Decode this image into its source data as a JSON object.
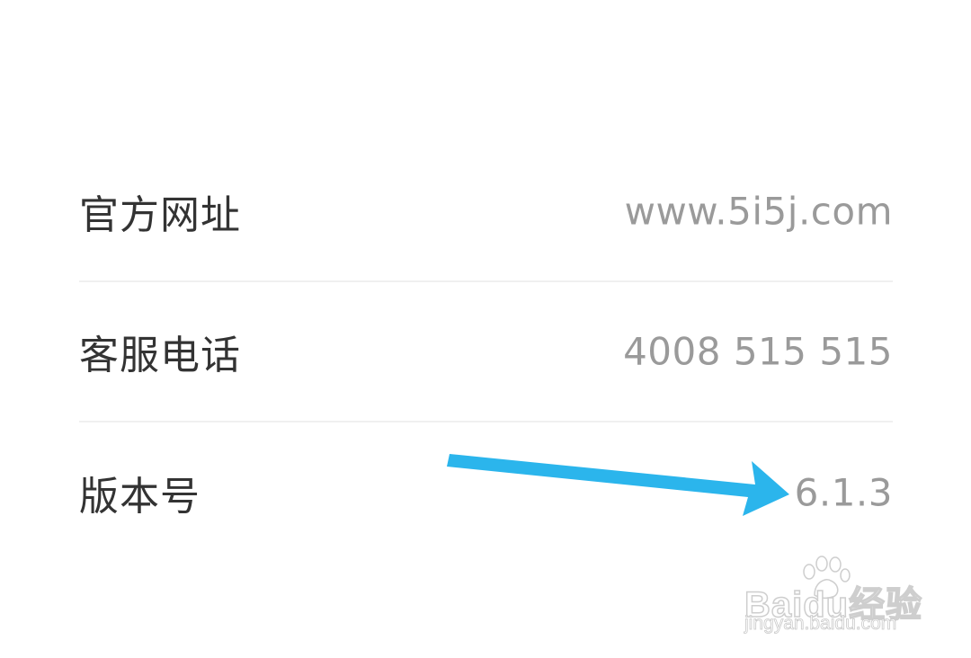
{
  "about": {
    "rows": [
      {
        "label": "官方网址",
        "value": "www.5i5j.com"
      },
      {
        "label": "客服电话",
        "value": "4008 515 515"
      },
      {
        "label": "版本号",
        "value": "6.1.3"
      }
    ]
  },
  "annotation": {
    "arrow_color": "#2bb5ec"
  },
  "watermark": {
    "logo": "Baidu经验",
    "url": "jingyan.baidu.com"
  }
}
